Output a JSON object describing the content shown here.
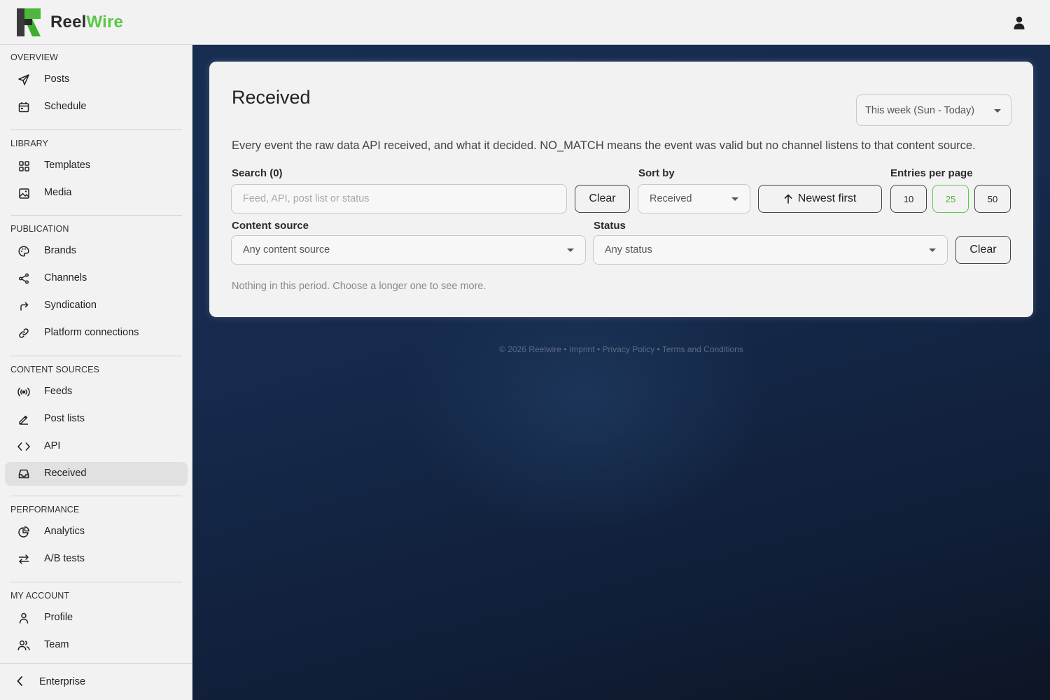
{
  "app": {
    "brand_part1": "Reel",
    "brand_part2": "Wire",
    "brand_color_green": "#5cc74a",
    "user_icon": "user-icon"
  },
  "sidebar": {
    "sections": [
      {
        "title": "OVERVIEW",
        "items": [
          {
            "label": "Posts",
            "icon": "send-icon"
          },
          {
            "label": "Schedule",
            "icon": "calendar-icon"
          }
        ]
      },
      {
        "title": "LIBRARY",
        "items": [
          {
            "label": "Templates",
            "icon": "grid-icon"
          },
          {
            "label": "Media",
            "icon": "image-icon"
          }
        ]
      },
      {
        "title": "PUBLICATION",
        "items": [
          {
            "label": "Brands",
            "icon": "palette-icon"
          },
          {
            "label": "Channels",
            "icon": "share-icon"
          },
          {
            "label": "Syndication",
            "icon": "forward-arrow-icon"
          },
          {
            "label": "Platform connections",
            "icon": "link-icon"
          }
        ]
      },
      {
        "title": "CONTENT SOURCES",
        "items": [
          {
            "label": "Feeds",
            "icon": "broadcast-icon"
          },
          {
            "label": "Post lists",
            "icon": "pencil-icon"
          },
          {
            "label": "API",
            "icon": "code-icon"
          },
          {
            "label": "Received",
            "icon": "inbox-icon",
            "active": true
          }
        ]
      },
      {
        "title": "PERFORMANCE",
        "items": [
          {
            "label": "Analytics",
            "icon": "pie-chart-icon"
          },
          {
            "label": "A/B tests",
            "icon": "swap-icon"
          }
        ]
      },
      {
        "title": "MY ACCOUNT",
        "items": [
          {
            "label": "Profile",
            "icon": "user-icon"
          },
          {
            "label": "Team",
            "icon": "team-icon"
          }
        ]
      }
    ],
    "bottom": {
      "label": "Enterprise",
      "icon": "chevron-left-icon"
    }
  },
  "main": {
    "title": "Received",
    "period": "This week (Sun - Today)",
    "description": "Every event the raw data API received, and what it decided. NO_MATCH means the event was valid but no channel listens to that content source.",
    "search_label": "Search (0)",
    "search_placeholder": "Feed, API, post list or status",
    "clear_label": "Clear",
    "sort_label": "Sort by",
    "sort_value": "Received",
    "order_label": "Newest first",
    "entries_label": "Entries per page",
    "entries_options": [
      "10",
      "25",
      "50"
    ],
    "entries_selected": "25",
    "content_source_label": "Content source",
    "content_source_value": "Any content source",
    "status_label": "Status",
    "status_value": "Any status",
    "clear_filters_label": "Clear",
    "empty_message": "Nothing in this period. Choose a longer one to see more."
  },
  "footer": {
    "copyright": "© 2026 Reelwire",
    "separator": " • ",
    "links": [
      "Imprint",
      "Privacy Policy",
      "Terms and Conditions"
    ]
  }
}
